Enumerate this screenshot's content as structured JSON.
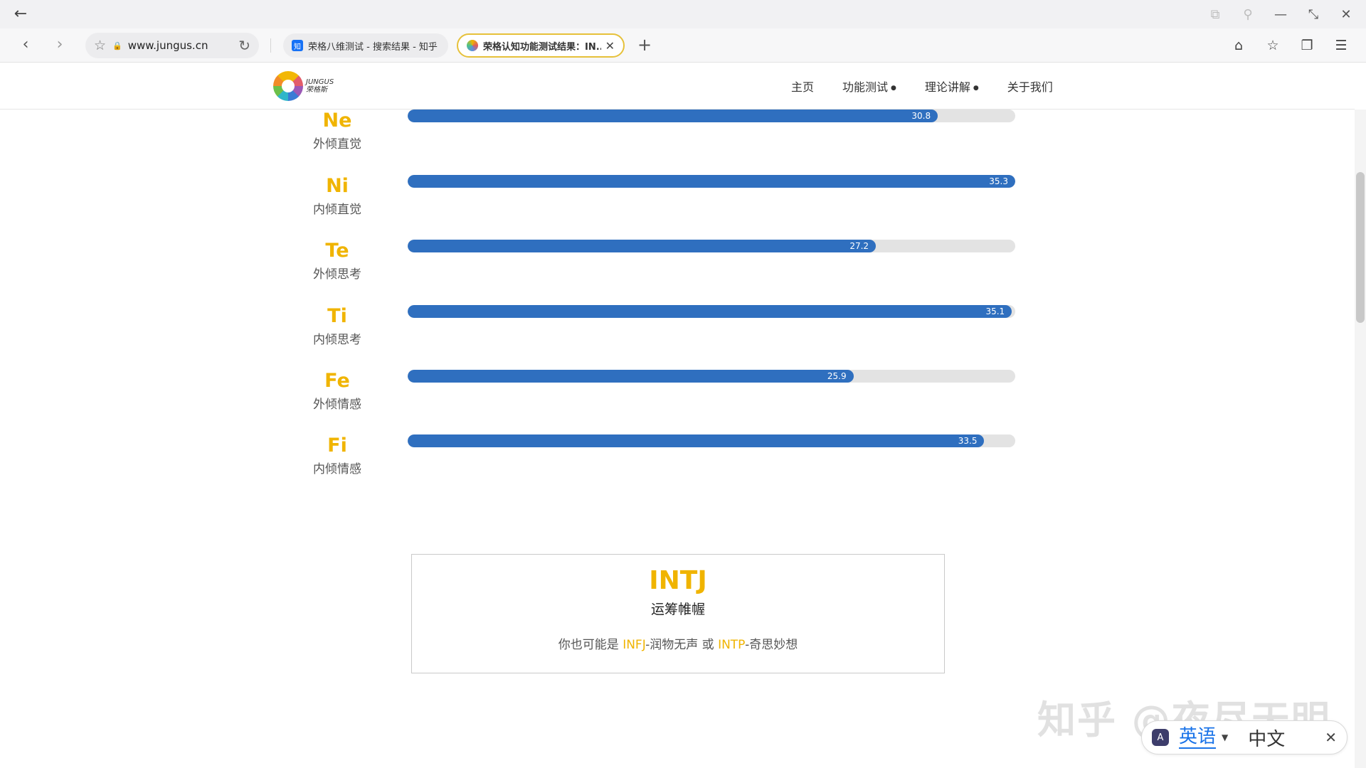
{
  "browser": {
    "url": "www.jungus.cn",
    "tabs": [
      {
        "icon": "知",
        "title": "荣格八维测试 - 搜索结果 - 知乎",
        "active": false
      },
      {
        "icon": "",
        "title": "荣格认知功能测试结果：IN...",
        "active": true
      }
    ]
  },
  "site": {
    "logo_line1": "JUNGUS",
    "logo_line2": "荣格斯",
    "menu": [
      {
        "label": "主页",
        "has_dropdown": false
      },
      {
        "label": "功能测试",
        "has_dropdown": true
      },
      {
        "label": "理论讲解",
        "has_dropdown": true
      },
      {
        "label": "关于我们",
        "has_dropdown": false
      }
    ]
  },
  "scores": {
    "max": 35.3,
    "items": [
      {
        "code": "Ne",
        "name": "外倾直觉",
        "value": 30.8,
        "label": "30.8"
      },
      {
        "code": "Ni",
        "name": "内倾直觉",
        "value": 35.3,
        "label": "35.3"
      },
      {
        "code": "Te",
        "name": "外倾思考",
        "value": 27.2,
        "label": "27.2"
      },
      {
        "code": "Ti",
        "name": "内倾思考",
        "value": 35.1,
        "label": "35.1"
      },
      {
        "code": "Fe",
        "name": "外倾情感",
        "value": 25.9,
        "label": "25.9"
      },
      {
        "code": "Fi",
        "name": "内倾情感",
        "value": 33.5,
        "label": "33.5"
      }
    ]
  },
  "result": {
    "type": "INTJ",
    "name": "运筹帷幄",
    "alt_prefix": "你也可能是 ",
    "alt1_type": "INFJ",
    "alt1_name": "-润物无声",
    "alt_mid": " 或 ",
    "alt2_type": "INTP",
    "alt2_name": "-奇思妙想"
  },
  "watermark": "知乎 @夜尽天明",
  "translate": {
    "icon": "A",
    "source": "英语",
    "target": "中文"
  },
  "colors": {
    "accent": "#f0b400",
    "bar": "#2f6fbf",
    "track": "#e3e3e3"
  }
}
